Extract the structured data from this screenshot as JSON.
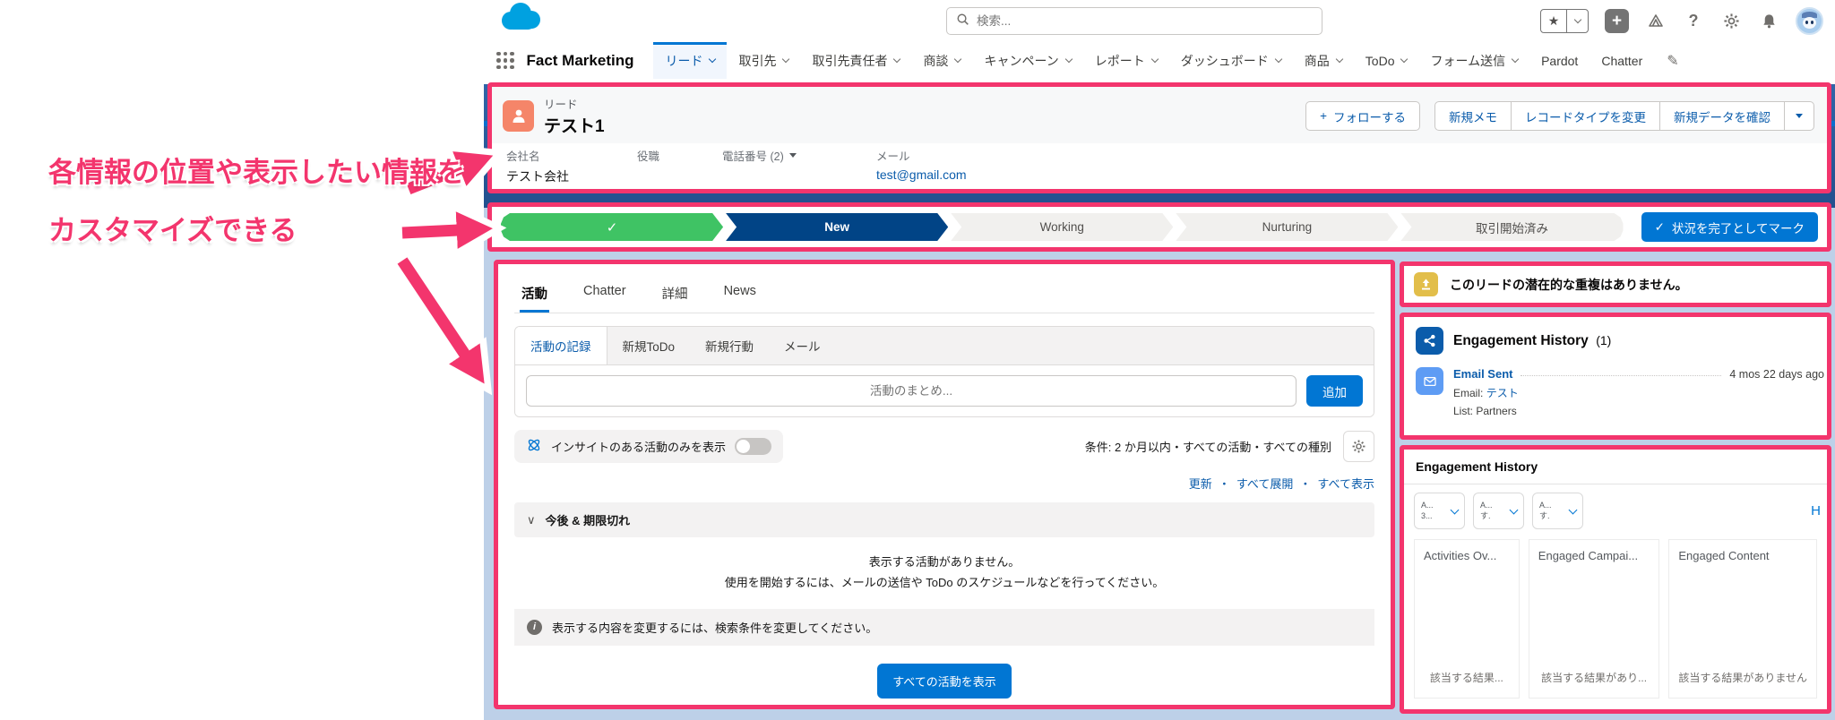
{
  "icons": {
    "plus": "+",
    "star": "★",
    "check": "✓",
    "question": "?",
    "pencil": "✎",
    "section_chevron": "∨",
    "info_glyph": "i"
  },
  "annotation": {
    "line1": "各情報の位置や表示したい情報を",
    "line2": "カスタマイズできる",
    "accent_color": "#f3356d"
  },
  "chrome": {
    "search_placeholder": "検索...",
    "app_name": "Fact Marketing",
    "tabs": [
      {
        "label": "リード",
        "selected": true
      },
      {
        "label": "取引先"
      },
      {
        "label": "取引先責任者"
      },
      {
        "label": "商談"
      },
      {
        "label": "キャンペーン"
      },
      {
        "label": "レポート"
      },
      {
        "label": "ダッシュボード"
      },
      {
        "label": "商品"
      },
      {
        "label": "ToDo"
      },
      {
        "label": "フォーム送信"
      },
      {
        "label": "Pardot"
      },
      {
        "label": "Chatter"
      }
    ]
  },
  "record_header": {
    "object_label": "リード",
    "record_name": "テスト1",
    "follow_label": "フォローする",
    "actions": [
      "新規メモ",
      "レコードタイプを変更",
      "新規データを確認"
    ],
    "fields": [
      {
        "label": "会社名",
        "value": "テスト会社"
      },
      {
        "label": "役職",
        "value": ""
      },
      {
        "label": "電話番号 (2)",
        "value": ""
      },
      {
        "label": "メール",
        "value": "test@gmail.com"
      }
    ]
  },
  "path": {
    "steps": [
      {
        "label": "",
        "state": "completed"
      },
      {
        "label": "New",
        "state": "current"
      },
      {
        "label": "Working",
        "state": "incomplete"
      },
      {
        "label": "Nurturing",
        "state": "incomplete"
      },
      {
        "label": "取引開始済み",
        "state": "incomplete"
      }
    ],
    "mark_complete_label": "状況を完了としてマーク",
    "current_color": "#014486",
    "completed_color": "#3fc364",
    "button_color": "#0176d3"
  },
  "activity": {
    "tabs": [
      "活動",
      "Chatter",
      "詳細",
      "News"
    ],
    "subtabs": [
      "活動の記録",
      "新規ToDo",
      "新規行動",
      "メール"
    ],
    "composer_placeholder": "活動のまとめ...",
    "add_label": "追加",
    "insights_toggle_label": "インサイトのある活動のみを表示",
    "filter_summary": "条件: 2 か月以内・すべての活動・すべての種別",
    "links": [
      "更新",
      "すべて展開",
      "すべて表示"
    ],
    "links_separator": "・",
    "section_title": "今後 & 期限切れ",
    "empty_line1": "表示する活動がありません。",
    "empty_line2": "使用を開始するには、メールの送信や ToDo のスケジュールなどを行ってください。",
    "info_message": "表示する内容を変更するには、検索条件を変更してください。",
    "view_all_label": "すべての活動を表示"
  },
  "right_rail": {
    "duplicate_notice": "このリードの潜在的な重複はありません。",
    "engagement_card": {
      "title": "Engagement History",
      "count": "(1)",
      "item_title": "Email Sent",
      "item_time": "4 mos 22 days ago",
      "email_label": "Email:",
      "email_value": "テスト",
      "list_line": "List: Partners"
    },
    "engagement_report": {
      "title": "Engagement History",
      "dropdowns": [
        {
          "line1": "A...",
          "line2": "3..."
        },
        {
          "line1": "A...",
          "line2": "す."
        },
        {
          "line1": "A...",
          "line2": "す."
        }
      ],
      "link_label": "H",
      "columns": [
        {
          "title": "Activities Ov...",
          "empty": "該当する結果..."
        },
        {
          "title": "Engaged Campai...",
          "empty": "該当する結果があり..."
        },
        {
          "title": "Engaged Content",
          "empty": "該当する結果がありません"
        }
      ]
    }
  }
}
